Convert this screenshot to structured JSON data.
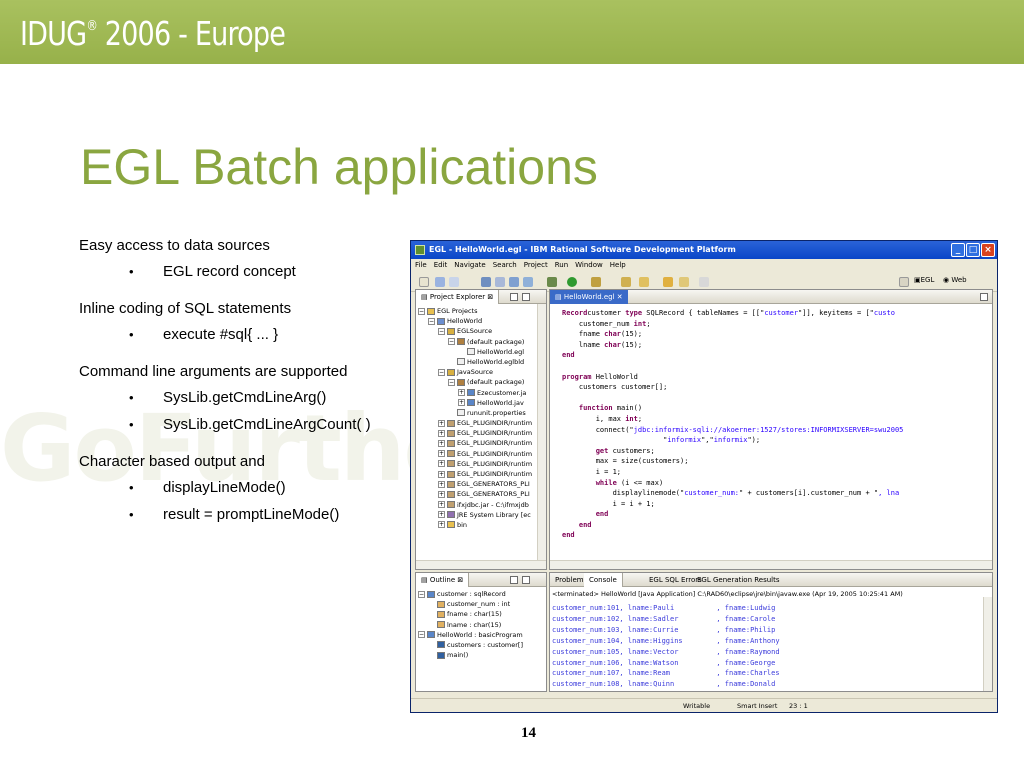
{
  "banner": {
    "text": "IDUG",
    "reg": "®",
    "year_suffix": " 2006 - Europe"
  },
  "watermark": "GoFurther",
  "slide_title": "EGL Batch applications",
  "bullets": [
    {
      "level": 1,
      "text": "Easy access to data sources"
    },
    {
      "level": 2,
      "text": "EGL record concept"
    },
    {
      "level": 1,
      "text": "Inline coding of SQL statements"
    },
    {
      "level": 2,
      "text": "execute #sql{ ... }"
    },
    {
      "level": 1,
      "text": "Command line arguments are supported"
    },
    {
      "level": 2,
      "text": "SysLib.getCmdLineArg()"
    },
    {
      "level": 2,
      "text": "SysLib.getCmdLineArgCount( )"
    },
    {
      "level": 1,
      "text": "Character based output and"
    },
    {
      "level": 2,
      "text": "displayLineMode()"
    },
    {
      "level": 2,
      "text": "result = promptLineMode()"
    }
  ],
  "page_number": "14",
  "ide": {
    "window_title": "EGL - HelloWorld.egl - IBM Rational Software Development Platform",
    "menu": [
      "File",
      "Edit",
      "Navigate",
      "Search",
      "Project",
      "Run",
      "Window",
      "Help"
    ],
    "perspectives": [
      "EGL",
      "Web"
    ],
    "project_explorer_tab": "Project Explorer",
    "tree": [
      {
        "indent": 0,
        "toggle": "−",
        "label": "EGL Projects",
        "icon": "folder-icon"
      },
      {
        "indent": 1,
        "toggle": "−",
        "label": "HelloWorld",
        "icon": "project-icon"
      },
      {
        "indent": 2,
        "toggle": "−",
        "label": "EGLSource",
        "icon": "source-folder-icon"
      },
      {
        "indent": 3,
        "toggle": "−",
        "label": "(default package)",
        "icon": "package-icon"
      },
      {
        "indent": 4,
        "toggle": "",
        "label": "HelloWorld.egl",
        "icon": "file-icon"
      },
      {
        "indent": 3,
        "toggle": "",
        "label": "HelloWorld.eglbld",
        "icon": "file-icon"
      },
      {
        "indent": 2,
        "toggle": "−",
        "label": "JavaSource",
        "icon": "source-folder-icon"
      },
      {
        "indent": 3,
        "toggle": "−",
        "label": "(default package)",
        "icon": "package-icon"
      },
      {
        "indent": 4,
        "toggle": "+",
        "label": "Ezecustomer.ja",
        "icon": "java-file-icon"
      },
      {
        "indent": 4,
        "toggle": "+",
        "label": "HelloWorld.jav",
        "icon": "java-file-icon"
      },
      {
        "indent": 3,
        "toggle": "",
        "label": "rununit.properties",
        "icon": "file-icon"
      },
      {
        "indent": 2,
        "toggle": "+",
        "label": "EGL_PLUGINDIR/runtim",
        "icon": "jar-icon"
      },
      {
        "indent": 2,
        "toggle": "+",
        "label": "EGL_PLUGINDIR/runtim",
        "icon": "jar-icon"
      },
      {
        "indent": 2,
        "toggle": "+",
        "label": "EGL_PLUGINDIR/runtim",
        "icon": "jar-icon"
      },
      {
        "indent": 2,
        "toggle": "+",
        "label": "EGL_PLUGINDIR/runtim",
        "icon": "jar-icon"
      },
      {
        "indent": 2,
        "toggle": "+",
        "label": "EGL_PLUGINDIR/runtim",
        "icon": "jar-icon"
      },
      {
        "indent": 2,
        "toggle": "+",
        "label": "EGL_PLUGINDIR/runtim",
        "icon": "jar-icon"
      },
      {
        "indent": 2,
        "toggle": "+",
        "label": "EGL_GENERATORS_PLI",
        "icon": "jar-icon"
      },
      {
        "indent": 2,
        "toggle": "+",
        "label": "EGL_GENERATORS_PLI",
        "icon": "jar-icon"
      },
      {
        "indent": 2,
        "toggle": "+",
        "label": "ifxjdbc.jar - C:\\ifmxjdb",
        "icon": "jar-icon"
      },
      {
        "indent": 2,
        "toggle": "+",
        "label": "JRE System Library [ec",
        "icon": "library-icon"
      },
      {
        "indent": 2,
        "toggle": "+",
        "label": "bin",
        "icon": "folder-icon"
      }
    ],
    "editor_tab": "HelloWorld.egl",
    "code_lines": [
      [
        [
          "kw",
          "Record"
        ],
        [
          "",
          "customer "
        ],
        [
          "kw",
          "type"
        ],
        [
          "",
          " SQLRecord { tableNames = [[\""
        ],
        [
          "st",
          "customer"
        ],
        [
          "",
          "\"]], keyitems = [\""
        ],
        [
          "st",
          "custo"
        ]
      ],
      [
        [
          "",
          "    customer_num "
        ],
        [
          "kw",
          "int"
        ],
        [
          "",
          ";"
        ]
      ],
      [
        [
          "",
          "    fname "
        ],
        [
          "kw",
          "char"
        ],
        [
          "",
          "(15);"
        ]
      ],
      [
        [
          "",
          "    lname "
        ],
        [
          "kw",
          "char"
        ],
        [
          "",
          "(15);"
        ]
      ],
      [
        [
          "kw",
          "end"
        ]
      ],
      [
        [
          "",
          ""
        ]
      ],
      [
        [
          "kw",
          "program"
        ],
        [
          "",
          " HelloWorld"
        ]
      ],
      [
        [
          "",
          "    customers customer[];"
        ]
      ],
      [
        [
          "",
          ""
        ]
      ],
      [
        [
          "",
          "    "
        ],
        [
          "kw",
          "function"
        ],
        [
          "",
          " main()"
        ]
      ],
      [
        [
          "",
          "        i, max "
        ],
        [
          "kw",
          "int"
        ],
        [
          "",
          ";"
        ]
      ],
      [
        [
          "",
          "        connect(\""
        ],
        [
          "st",
          "jdbc:informix-sqli://akoerner:1527/stores:INFORMIXSERVER=swu2005"
        ]
      ],
      [
        [
          "",
          "                        \""
        ],
        [
          "st",
          "informix"
        ],
        [
          "",
          "\",\""
        ],
        [
          "st",
          "informix"
        ],
        [
          "",
          "\");"
        ]
      ],
      [
        [
          "",
          "        "
        ],
        [
          "kw",
          "get"
        ],
        [
          "",
          " customers;"
        ]
      ],
      [
        [
          "",
          "        max = size(customers);"
        ]
      ],
      [
        [
          "",
          "        i = 1;"
        ]
      ],
      [
        [
          "",
          "        "
        ],
        [
          "kw",
          "while"
        ],
        [
          "",
          " (i <= max)"
        ]
      ],
      [
        [
          "",
          "            displaylinemode(\""
        ],
        [
          "st",
          "customer_num:"
        ],
        [
          "",
          "\" + customers[i].customer_num + \""
        ],
        [
          "st",
          ", lna"
        ]
      ],
      [
        [
          "",
          "            i = i + 1;"
        ]
      ],
      [
        [
          "",
          "        "
        ],
        [
          "kw",
          "end"
        ]
      ],
      [
        [
          "",
          "    "
        ],
        [
          "kw",
          "end"
        ]
      ],
      [
        [
          "kw",
          "end"
        ]
      ]
    ],
    "outline_tab": "Outline",
    "outline": [
      {
        "indent": 0,
        "toggle": "−",
        "label": "customer : sqlRecord",
        "icon": "record-icon"
      },
      {
        "indent": 1,
        "toggle": "",
        "label": "customer_num : int",
        "icon": "field-icon"
      },
      {
        "indent": 1,
        "toggle": "",
        "label": "fname : char(15)",
        "icon": "field-icon"
      },
      {
        "indent": 1,
        "toggle": "",
        "label": "lname : char(15)",
        "icon": "field-icon"
      },
      {
        "indent": 0,
        "toggle": "−",
        "label": "HelloWorld : basicProgram",
        "icon": "program-icon"
      },
      {
        "indent": 1,
        "toggle": "",
        "label": "customers : customer[]",
        "icon": "variable-icon"
      },
      {
        "indent": 1,
        "toggle": "",
        "label": "main()",
        "icon": "function-icon"
      }
    ],
    "bottom_tabs": [
      "Problems",
      "Console",
      "EGL SQL Errors",
      "EGL Generation Results"
    ],
    "console_header": "<terminated> HelloWorld [Java Application] C:\\RAD60\\eclipse\\jre\\bin\\javaw.exe (Apr 19, 2005 10:25:41 AM)",
    "console_lines": [
      "customer_num:101, lname:Pauli          , fname:Ludwig",
      "customer_num:102, lname:Sadler         , fname:Carole",
      "customer_num:103, lname:Currie         , fname:Philip",
      "customer_num:104, lname:Higgins        , fname:Anthony",
      "customer_num:105, lname:Vector         , fname:Raymond",
      "customer_num:106, lname:Watson         , fname:George",
      "customer_num:107, lname:Ream           , fname:Charles",
      "customer_num:108, lname:Quinn          , fname:Donald"
    ],
    "status": {
      "mode": "Writable",
      "insert": "Smart Insert",
      "position": "23 : 1"
    }
  }
}
